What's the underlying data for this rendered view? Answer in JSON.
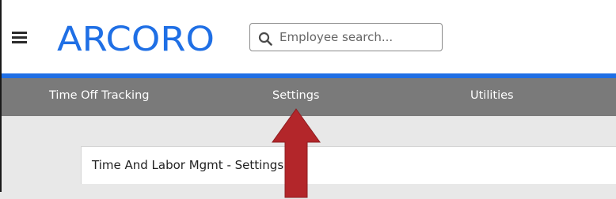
{
  "header": {
    "logo_text": "ARCORO",
    "brand_color": "#1f6fe5"
  },
  "search": {
    "placeholder": "Employee search..."
  },
  "nav": {
    "items": [
      {
        "label": "Time Off Tracking"
      },
      {
        "label": "Settings"
      },
      {
        "label": "Utilities"
      }
    ]
  },
  "panel": {
    "title": "Time And Labor Mgmt - Settings"
  },
  "annotation": {
    "arrow_color": "#b3262a",
    "arrow_direction": "up"
  }
}
